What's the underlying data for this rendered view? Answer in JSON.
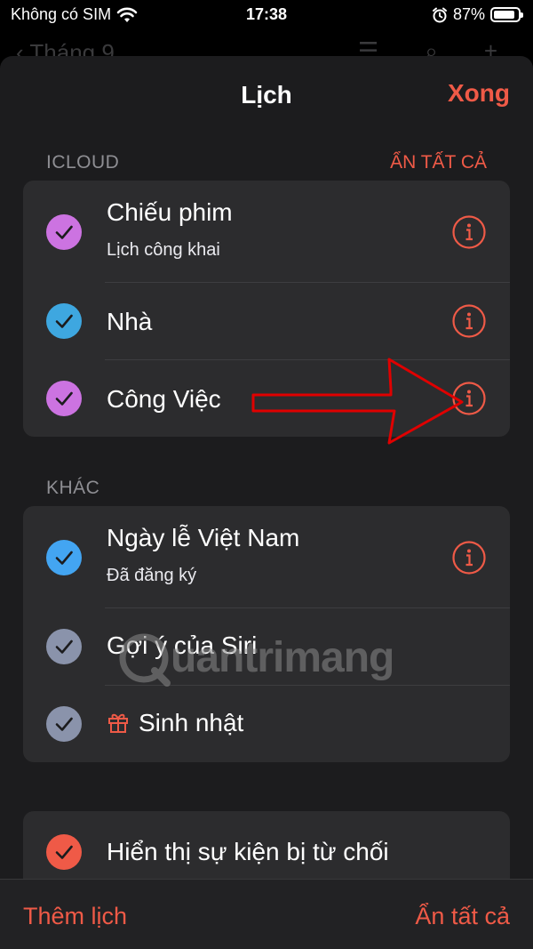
{
  "status_bar": {
    "carrier": "Không có SIM",
    "time": "17:38",
    "battery_percent": "87%",
    "battery_level": 0.87,
    "icons": [
      "wifi-icon",
      "alarm-icon",
      "battery-icon"
    ]
  },
  "background_nav": {
    "back_label": "Tháng 9"
  },
  "sheet": {
    "title": "Lịch",
    "done_label": "Xong"
  },
  "icloud_section": {
    "header": "ICLOUD",
    "hide_all_label": "ẨN TẤT CẢ",
    "items": [
      {
        "title": "Chiếu phim",
        "subtitle": "Lịch công khai",
        "color": "#cc73e1",
        "checked": true
      },
      {
        "title": "Nhà",
        "subtitle": "",
        "color": "#3ea7e0",
        "checked": true
      },
      {
        "title": "Công Việc",
        "subtitle": "",
        "color": "#cc73e1",
        "checked": true
      }
    ]
  },
  "other_section": {
    "header": "KHÁC",
    "items": [
      {
        "title": "Ngày lễ Việt Nam",
        "subtitle": "Đã đăng ký",
        "color": "#43a5f2",
        "checked": true
      },
      {
        "title": "Gợi ý của Siri",
        "subtitle": "",
        "color": "#8a93ab",
        "checked": true
      },
      {
        "title": "Sinh nhật",
        "subtitle": "",
        "color": "#8a93ab",
        "checked": true,
        "icon": "gift-icon"
      }
    ]
  },
  "declined_section": {
    "items": [
      {
        "title": "Hiển thị sự kiện bị từ chối",
        "color": "#ef5a47",
        "checked": true
      }
    ]
  },
  "bottom_bar": {
    "add_calendar_label": "Thêm lịch",
    "hide_all_label": "Ẩn tất cả"
  },
  "watermark": {
    "text": "uantrimang"
  },
  "colors": {
    "accent": "#ef5a47",
    "sheet_bg": "#1c1c1e",
    "group_bg": "#2c2c2e",
    "annotation_arrow": "#e00000"
  }
}
